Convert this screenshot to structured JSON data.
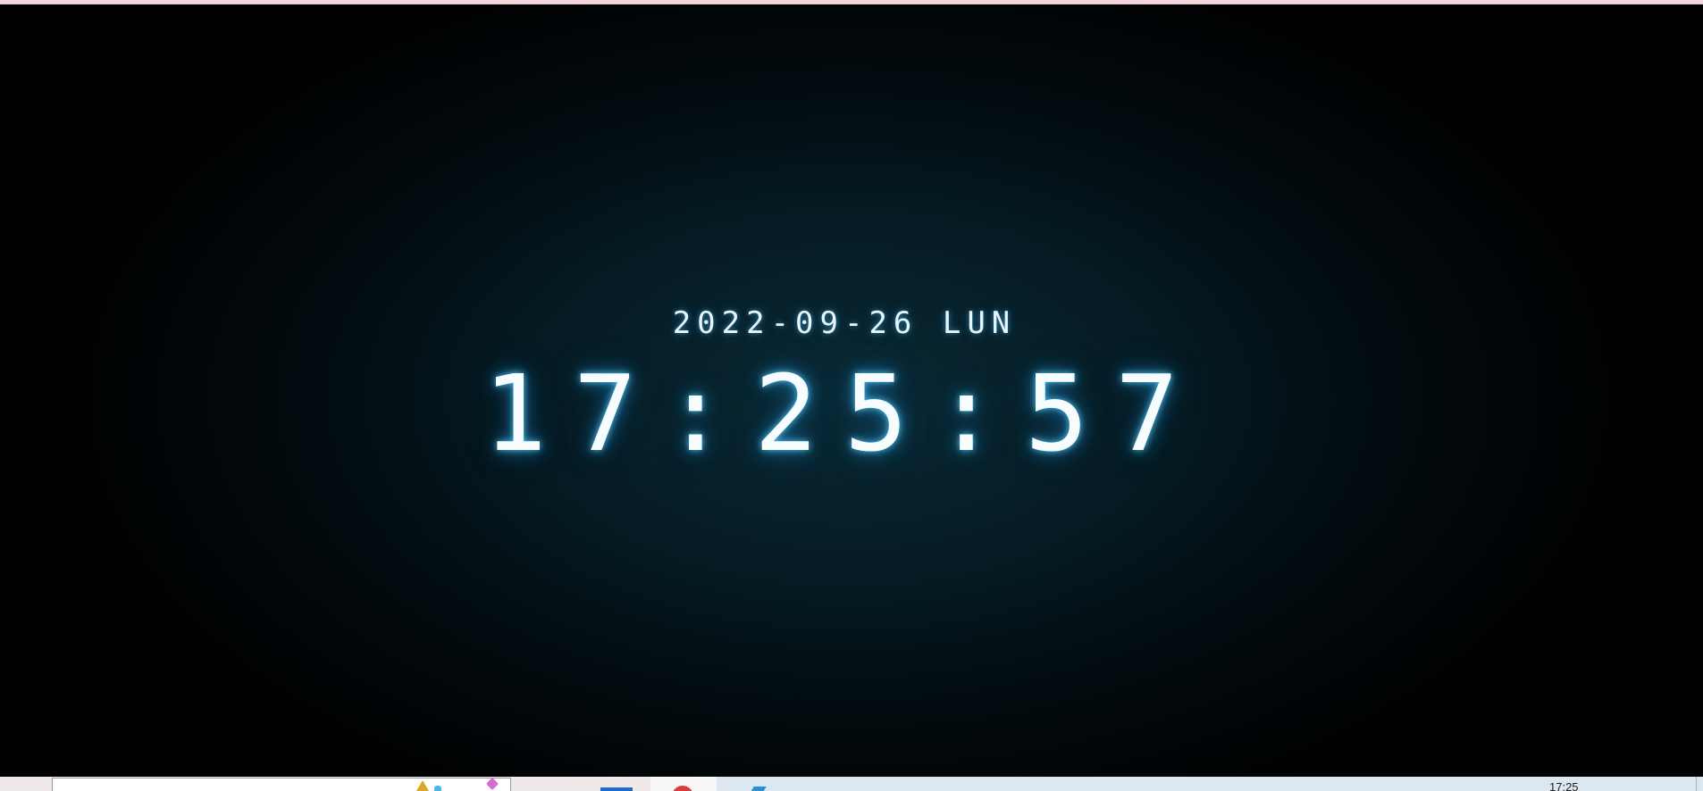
{
  "clock": {
    "date": "2022-09-26 LUN",
    "time": "17:25:57"
  },
  "taskbar": {
    "clock": "17:25",
    "icons": [
      "warning-icon",
      "cloud-icon",
      "pin-icon",
      "app-blue-icon",
      "chrome-icon",
      "edge-icon"
    ]
  },
  "colors": {
    "background": "#000000",
    "glow": "#0a2a36",
    "text": "#f7fdff",
    "accent_glow": "#5ad2ff",
    "top_strip": "#f3d7dc"
  }
}
